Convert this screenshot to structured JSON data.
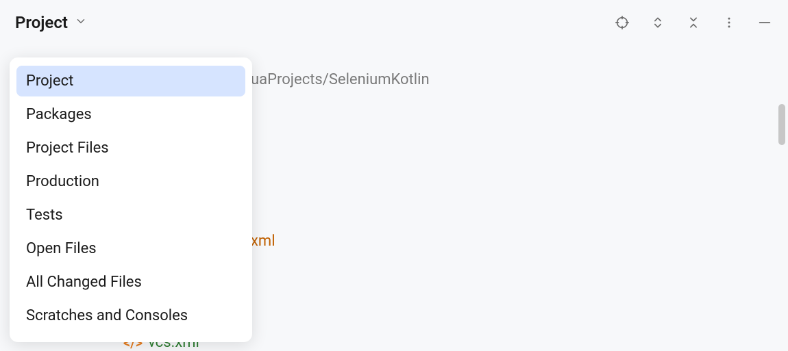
{
  "toolbar": {
    "current_view": "Project"
  },
  "dropdown": {
    "items": [
      {
        "label": "Project",
        "selected": true
      },
      {
        "label": "Packages",
        "selected": false
      },
      {
        "label": "Project Files",
        "selected": false
      },
      {
        "label": "Production",
        "selected": false
      },
      {
        "label": "Tests",
        "selected": false
      },
      {
        "label": "Open Files",
        "selected": false
      },
      {
        "label": "All Changed Files",
        "selected": false
      },
      {
        "label": "Scratches and Consoles",
        "selected": false
      }
    ]
  },
  "background": {
    "project_path_fragment": "uaProjects/SeleniumKotlin",
    "partial_file_1": "xml",
    "partial_file_2": "vcs.xml"
  }
}
